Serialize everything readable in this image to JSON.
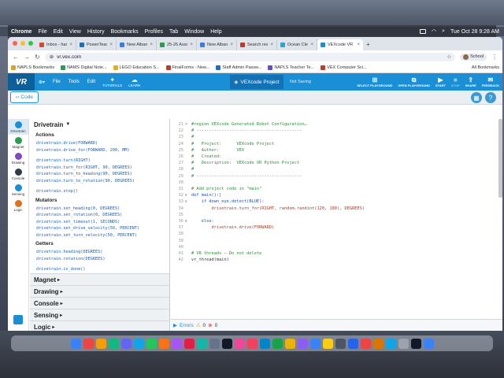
{
  "menubar": {
    "app": "Chrome",
    "items": [
      "File",
      "Edit",
      "View",
      "History",
      "Bookmarks",
      "Profiles",
      "Tab",
      "Window",
      "Help"
    ],
    "datetime": "Tue Oct 28  9:28 AM"
  },
  "browser": {
    "tabs": [
      {
        "label": "Inbox - hartley",
        "color": "#d44638"
      },
      {
        "label": "PowerTeacher",
        "color": "#1f6fbf"
      },
      {
        "label": "New Albany - ...",
        "color": "#3e7ae0"
      },
      {
        "label": "25-26 Assignm...",
        "color": "#2d9b54"
      },
      {
        "label": "New Albany Pl...",
        "color": "#3e7ae0"
      },
      {
        "label": "Search results",
        "color": "#c0392b"
      },
      {
        "label": "Ocean Clean U...",
        "color": "#2aa6c9"
      },
      {
        "label": "VEXcode VR",
        "color": "#1b8fd6",
        "active": true
      }
    ],
    "newtab": "+",
    "url": "vr.vex.com",
    "profile": "School",
    "bookmarks": [
      {
        "label": "NAPLS Bookmarks",
        "color": "#d8a32a"
      },
      {
        "label": "NAMS Digital Note...",
        "color": "#2d9b54"
      },
      {
        "label": "LEGO Education S...",
        "color": "#e0b020"
      },
      {
        "label": "FinalForms - New...",
        "color": "#c0392b"
      },
      {
        "label": "Staff Admin Passw...",
        "color": "#1f6fbf"
      },
      {
        "label": "NAPLS Teacher Te...",
        "color": "#6a4bbf"
      },
      {
        "label": "VEX Computer Sci...",
        "color": "#c0392b"
      }
    ],
    "all_bookmarks": "All Bookmarks"
  },
  "vexbar": {
    "logo": "VR",
    "file": "File",
    "tools": "Tools",
    "edit": "Edit",
    "tutorials": "TUTORIALS",
    "learn": "LEARN",
    "project": "VEXcode Project",
    "saving": "Not Saving",
    "right": [
      {
        "label": "SELECT PLAYGROUND",
        "icon": "⊞"
      },
      {
        "label": "OPEN PLAYGROUND",
        "icon": "⧉"
      },
      {
        "label": "START",
        "icon": "▶"
      },
      {
        "label": "STOP",
        "icon": "■",
        "dim": true
      },
      {
        "label": "SHARE",
        "icon": "⇪"
      },
      {
        "label": "FEEDBACK",
        "icon": "✉"
      }
    ]
  },
  "code_tab": "Code",
  "categories": [
    {
      "label": "Drivetrain",
      "color": "#1b8fd6",
      "selected": true
    },
    {
      "label": "Magnet",
      "color": "#2d9b54"
    },
    {
      "label": "Drawing",
      "color": "#7b4bbf"
    },
    {
      "label": "Console",
      "color": "#333a45"
    },
    {
      "label": "Sensing",
      "color": "#1b8fd6"
    },
    {
      "label": "Logic",
      "color": "#e07020"
    }
  ],
  "palette": {
    "header": "Drivetrain",
    "sections": [
      {
        "title": "Actions",
        "blocks": [
          "drivetrain.drive(FORWARD)",
          "drivetrain.drive_for(FORWARD, 200, MM)",
          "",
          "drivetrain.turn(RIGHT)",
          "drivetrain.turn_for(RIGHT, 90, DEGREES)",
          "drivetrain.turn_to_heading(90, DEGREES)",
          "drivetrain.turn_to_rotation(90, DEGREES)",
          "",
          "drivetrain.stop()"
        ]
      },
      {
        "title": "Mutators",
        "blocks": [
          "drivetrain.set_heading(0, DEGREES)",
          "drivetrain.set_rotation(0, DEGREES)",
          "drivetrain.set_timeout(1, SECONDS)",
          "drivetrain.set_drive_velocity(50, PERCENT)",
          "drivetrain.set_turn_velocity(50, PERCENT)"
        ]
      },
      {
        "title": "Getters",
        "blocks": [
          "drivetrain.heading(DEGREES)",
          "drivetrain.rotation(DEGREES)",
          "",
          "drivetrain.is_done()",
          "drivetrain.is_moving()"
        ]
      }
    ],
    "collapsed": [
      "Magnet",
      "Drawing",
      "Console",
      "Sensing",
      "Logic"
    ]
  },
  "editor": {
    "lines": [
      {
        "n": "21",
        "t": "#region VEXcode Generated Robot Configuration…",
        "c": "cm",
        "f": ">"
      },
      {
        "n": "22",
        "t": "# ------------------------------------------",
        "c": "cm"
      },
      {
        "n": "23",
        "t": "#",
        "c": "cm"
      },
      {
        "n": "24",
        "t": "#   Project:      VEXcode Project",
        "c": "cm"
      },
      {
        "n": "25",
        "t": "#   Author:       VEX",
        "c": "cm"
      },
      {
        "n": "26",
        "t": "#   Created:",
        "c": "cm"
      },
      {
        "n": "27",
        "t": "#   Description:  VEXcode VR Python Project",
        "c": "cm"
      },
      {
        "n": "28",
        "t": "#",
        "c": "cm"
      },
      {
        "n": "29",
        "t": "# ------------------------------------------",
        "c": "cm"
      },
      {
        "n": "30",
        "t": "",
        "c": ""
      },
      {
        "n": "31",
        "t": "# Add project code in \"main\"",
        "c": "cm"
      },
      {
        "n": "32",
        "t": "def main():|",
        "c": "kw",
        "f": "v"
      },
      {
        "n": "33",
        "t": "    if down_eye.detect(BLUE):",
        "c": "kw",
        "f": "v"
      },
      {
        "n": "34",
        "t": "        drivetrain.turn_for(RIGHT, random.randint(120, 180), DEGREES)",
        "c": "fn"
      },
      {
        "n": "35",
        "t": "",
        "c": ""
      },
      {
        "n": "36",
        "t": "    else:",
        "c": "kw",
        "f": "v"
      },
      {
        "n": "37",
        "t": "        drivetrain.drive(FORWARD)",
        "c": "fn"
      },
      {
        "n": "38",
        "t": "",
        "c": ""
      },
      {
        "n": "39",
        "t": "",
        "c": ""
      },
      {
        "n": "40",
        "t": "",
        "c": ""
      },
      {
        "n": "41",
        "t": "# VR threads — Do not delete",
        "c": "cm"
      },
      {
        "n": "42",
        "t": "vr_thread(main)",
        "c": ""
      }
    ]
  },
  "errors": {
    "label": "Errors",
    "warnings": "0",
    "errors": "0"
  }
}
